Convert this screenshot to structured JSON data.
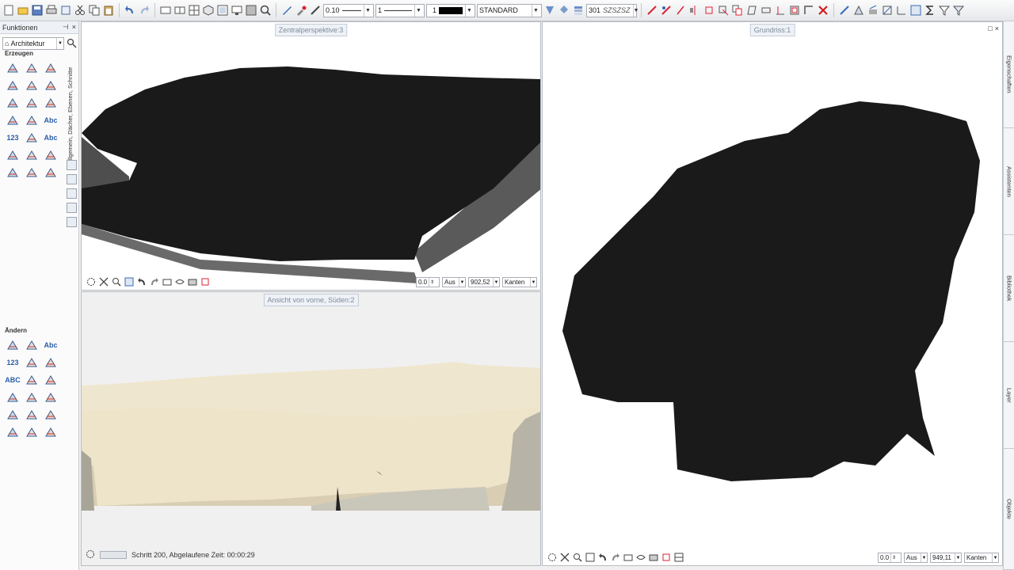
{
  "toolbar": {
    "pen_thickness": "0.10",
    "line_type": "1",
    "color_number": "1",
    "line_style": "STANDARD",
    "layer": "301",
    "layer_pattern": "SZSZSZ"
  },
  "left_panel": {
    "title": "Funktionen",
    "module": "Architektur",
    "section_create": "Erzeugen",
    "section_modify": "Ändern",
    "side_tab_label": "Allgemein, Dächer, Ebenen, Schnitte",
    "create_tools": [
      {
        "icon": "wall-icon"
      },
      {
        "icon": "roof-icon"
      },
      {
        "icon": "stair-icon"
      },
      {
        "icon": "slab-icon"
      },
      {
        "icon": "house-icon"
      },
      {
        "icon": "plane-icon"
      },
      {
        "icon": "surface-icon"
      },
      {
        "icon": "cube-icon"
      },
      {
        "icon": "door-icon"
      },
      {
        "icon": "dimension-icon"
      },
      {
        "icon": "level-icon"
      },
      {
        "icon": "text-icon",
        "label": "Abc"
      },
      {
        "icon": "number-icon",
        "label": "123"
      },
      {
        "icon": "grid-icon"
      },
      {
        "icon": "label-icon",
        "label": "Abc"
      },
      {
        "icon": "sheet-icon"
      },
      {
        "icon": "report-icon"
      },
      {
        "icon": "opening-icon"
      },
      {
        "icon": "modify-point-icon"
      },
      {
        "icon": "split-icon"
      },
      {
        "icon": "join-icon"
      }
    ],
    "modify_tools": [
      {
        "icon": "move-icon"
      },
      {
        "icon": "visibility-icon"
      },
      {
        "icon": "edit-text-icon",
        "label": "Abc"
      },
      {
        "icon": "renumber-icon",
        "label": "123"
      },
      {
        "icon": "copy-icon"
      },
      {
        "icon": "zoom-edit-icon"
      },
      {
        "icon": "text-modify-icon",
        "label": "ABC"
      },
      {
        "icon": "delete-segment-icon"
      },
      {
        "icon": "stretch-icon"
      },
      {
        "icon": "offset-icon"
      },
      {
        "icon": "attach-icon"
      },
      {
        "icon": "cut-icon"
      },
      {
        "icon": "mirror-icon"
      },
      {
        "icon": "group-icon"
      },
      {
        "icon": "parallel-icon"
      },
      {
        "icon": "remove-icon"
      },
      {
        "icon": "transfer-icon"
      },
      {
        "icon": "properties-icon"
      }
    ]
  },
  "viewports": {
    "perspective": {
      "title": "Zentralperspektive:3",
      "angle": "0.0",
      "mode": "Aus",
      "scale": "902,52",
      "display": "Kanten"
    },
    "front": {
      "title": "Ansicht von vorne, Süden:2",
      "status": "Schritt 200, Abgelaufene Zeit: 00:00:29"
    },
    "plan": {
      "title": "Grundriss:1",
      "angle": "0.0",
      "mode": "Aus",
      "scale": "949,11",
      "display": "Kanten"
    }
  },
  "right_tabs": [
    "Eigenschaften",
    "Assistenten",
    "Bibliothek",
    "Layer",
    "Objekte"
  ],
  "colors": {
    "mesh_fill": "#8c8c8c",
    "mesh_edge": "#1a1a1a",
    "terrain_sand": "#efe6cf",
    "accent_blue": "#2a5da8"
  }
}
